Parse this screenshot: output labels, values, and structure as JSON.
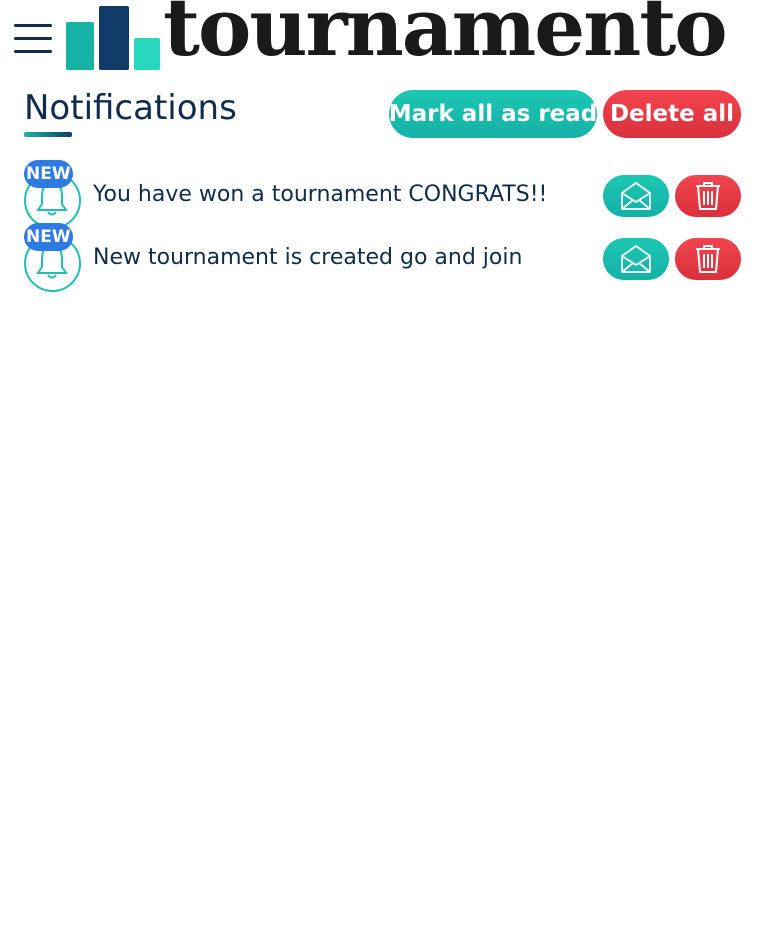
{
  "header": {
    "menu_icon": "hamburger-menu-icon",
    "logo_text": "tournamento",
    "logo_mark_colors": [
      "#0f3b66",
      "#16b2a5",
      "#27d6bd"
    ]
  },
  "page": {
    "title": "Notifications",
    "mark_all_label": "Mark all as read",
    "delete_all_label": "Delete all"
  },
  "notifications": [
    {
      "badge": "NEW",
      "icon": "bell-icon",
      "text": "You have won a tournament CONGRATS!!",
      "read_icon": "envelope-open-icon",
      "delete_icon": "trash-icon"
    },
    {
      "badge": "NEW",
      "icon": "bell-icon",
      "text": "New tournament is created go and join",
      "read_icon": "envelope-open-icon",
      "delete_icon": "trash-icon"
    }
  ],
  "colors": {
    "accent_teal": "#1dc7b4",
    "danger_red": "#e63a45",
    "badge_blue": "#2d7be3",
    "text_navy": "#0f2c4c"
  }
}
